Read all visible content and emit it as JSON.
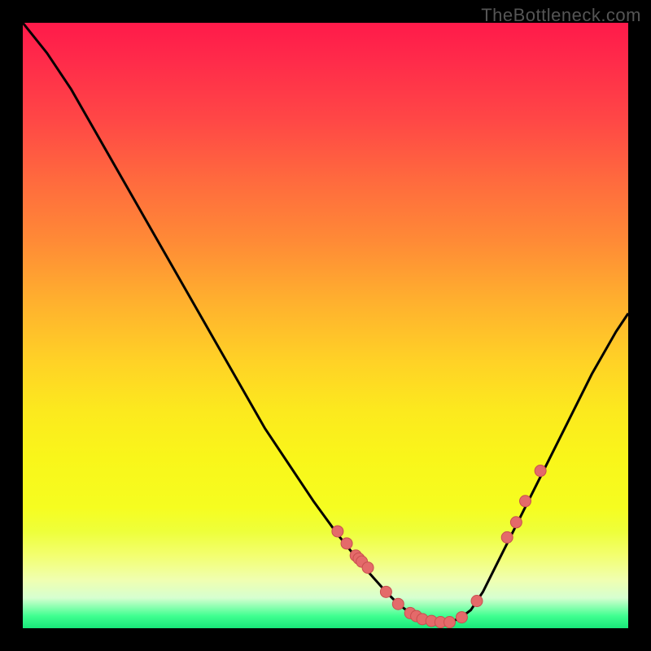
{
  "watermark": "TheBottleneck.com",
  "colors": {
    "curve": "#000000",
    "marker_fill": "#e46a6a",
    "marker_stroke": "#c94f4f"
  },
  "chart_data": {
    "type": "line",
    "title": "",
    "xlabel": "",
    "ylabel": "",
    "xlim": [
      0,
      100
    ],
    "ylim": [
      0,
      100
    ],
    "curve": {
      "x": [
        0,
        4,
        8,
        12,
        16,
        20,
        24,
        28,
        32,
        36,
        40,
        44,
        48,
        52,
        56,
        60,
        62,
        64,
        66,
        68,
        70,
        72,
        74,
        76,
        78,
        82,
        86,
        90,
        94,
        98,
        100
      ],
      "y": [
        100,
        95,
        89,
        82,
        75,
        68,
        61,
        54,
        47,
        40,
        33,
        27,
        21,
        15.5,
        10.5,
        6,
        4,
        2.5,
        1.5,
        1,
        1,
        1.5,
        3,
        6,
        10,
        18,
        26,
        34,
        42,
        49,
        52
      ]
    },
    "markers": {
      "x": [
        52,
        53.5,
        55,
        55.5,
        56,
        57,
        60,
        62,
        64,
        65,
        66,
        67.5,
        69,
        70.5,
        72.5,
        75,
        80,
        81.5,
        83,
        85.5
      ],
      "y": [
        16,
        14,
        12,
        11.5,
        11,
        10,
        6,
        4,
        2.5,
        2,
        1.5,
        1.2,
        1,
        1,
        1.8,
        4.5,
        15,
        17.5,
        21,
        26
      ]
    }
  }
}
